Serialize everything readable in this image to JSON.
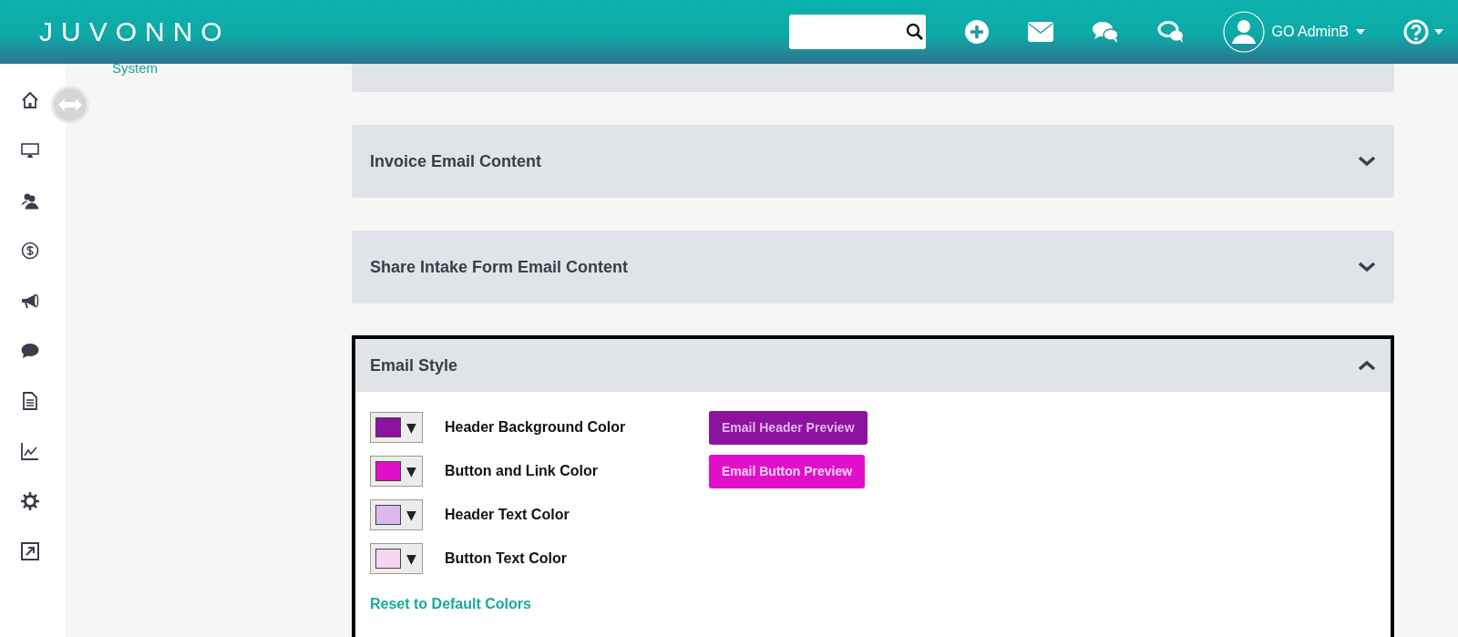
{
  "header": {
    "logo": "JUVONNO",
    "user": {
      "name": "GO AdminB"
    }
  },
  "sidebar": {
    "items": [
      {
        "kind": "home"
      },
      {
        "kind": "monitor"
      },
      {
        "kind": "people"
      },
      {
        "kind": "dollar"
      },
      {
        "kind": "megaphone"
      },
      {
        "kind": "chat"
      },
      {
        "kind": "document"
      },
      {
        "kind": "chart"
      },
      {
        "kind": "gear"
      },
      {
        "kind": "external"
      }
    ]
  },
  "left_nav": {
    "link": "System"
  },
  "panels": [
    {
      "kind": "cut"
    },
    {
      "kind": "accordion",
      "title": "Invoice Email Content",
      "expanded": false
    },
    {
      "kind": "accordion",
      "title": "Share Intake Form Email Content",
      "expanded": false
    },
    {
      "kind": "accordion",
      "title": "Email Style",
      "expanded": true
    }
  ],
  "email_style": {
    "pickers": [
      {
        "label": "Header Background Color",
        "color": "#8e12a0",
        "arrow": "▼"
      },
      {
        "label": "Button and Link Color",
        "color": "#e20fc9",
        "arrow": "▼"
      },
      {
        "label": "Header Text Color",
        "color": "#dcb8ec",
        "arrow": "▼"
      },
      {
        "label": "Button Text Color",
        "color": "#f5d5f2",
        "arrow": "▼"
      }
    ],
    "previews": [
      {
        "label": "Email Header Preview"
      },
      {
        "label": "Email Button Preview"
      }
    ],
    "reset_link": "Reset to Default Colors"
  }
}
